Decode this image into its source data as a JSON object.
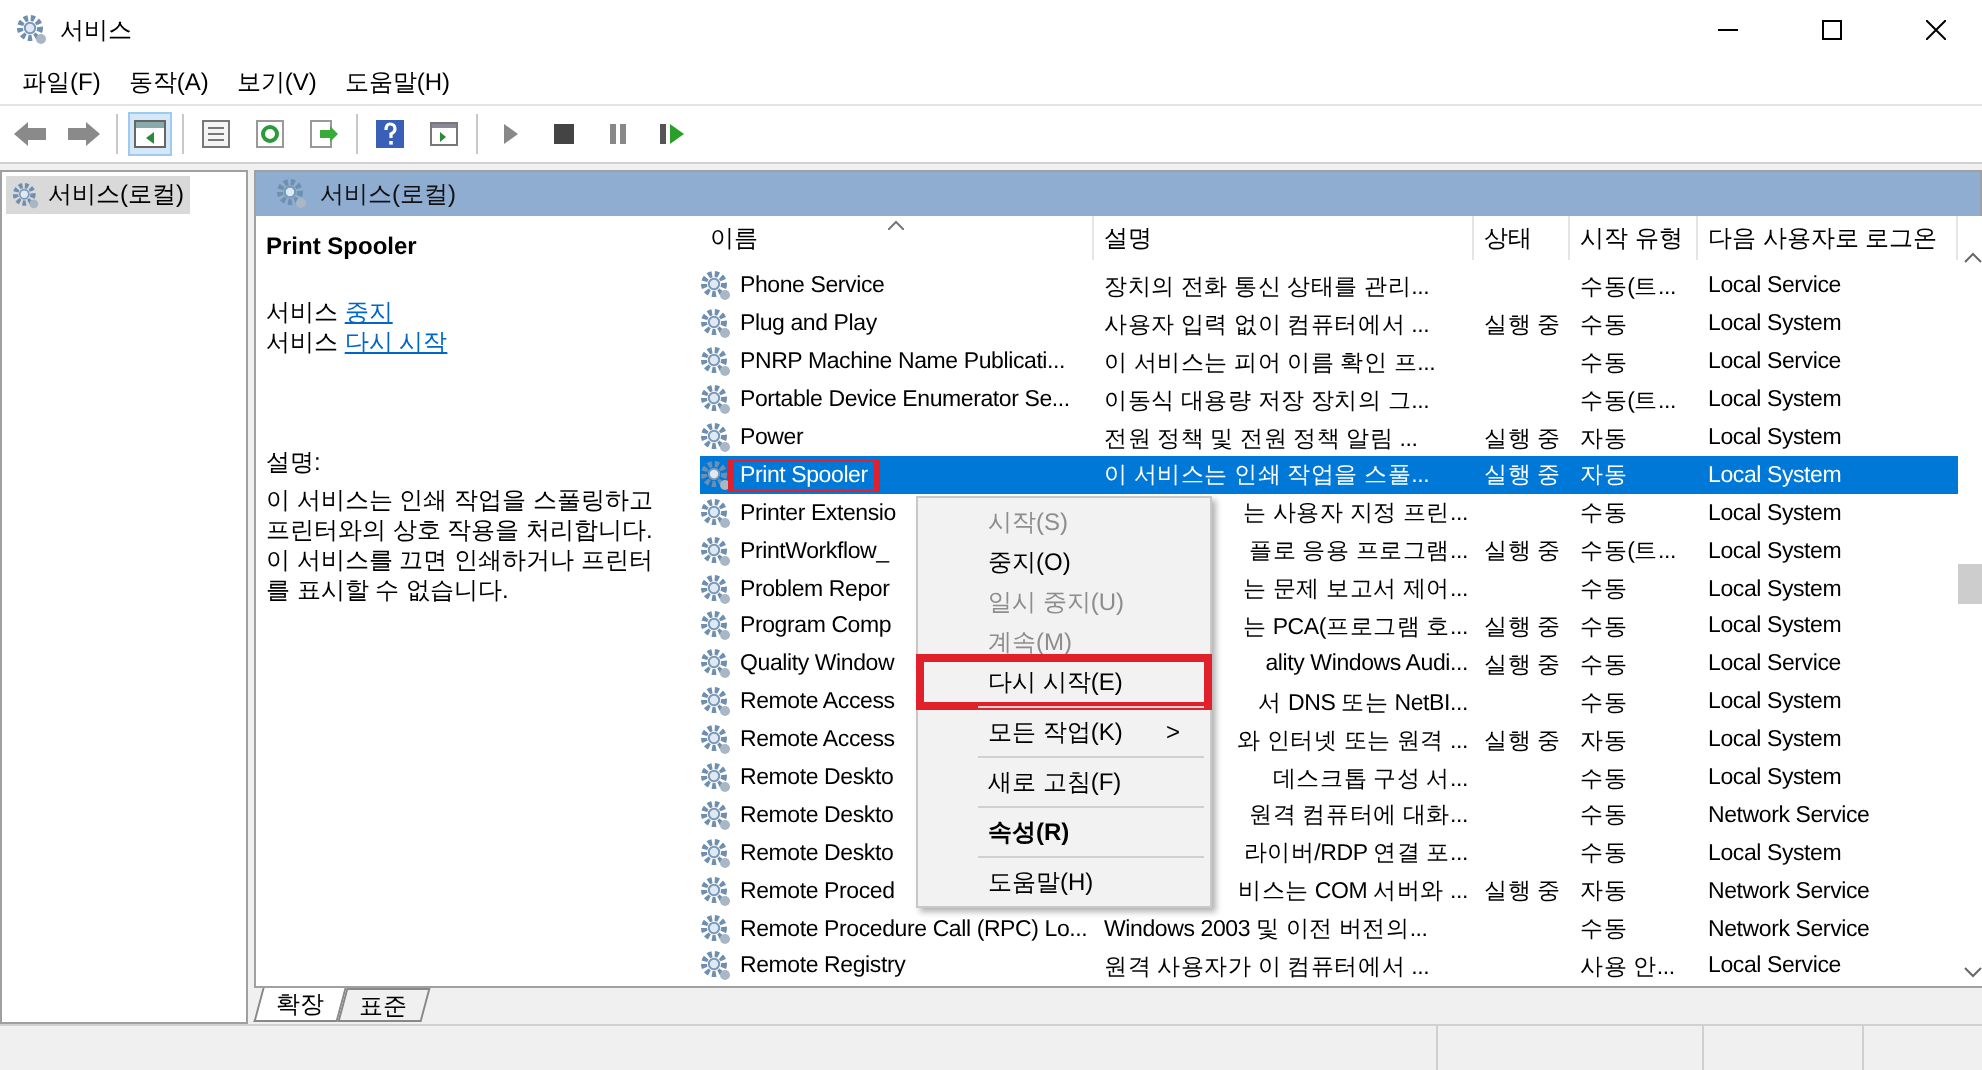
{
  "window": {
    "title": "서비스"
  },
  "menu_bar": [
    "파일(F)",
    "동작(A)",
    "보기(V)",
    "도움말(H)"
  ],
  "tree": [
    {
      "label": "서비스(로컬)",
      "selected": true
    }
  ],
  "panel_title": "서비스(로컬)",
  "details": {
    "service_name": "Print Spooler",
    "actions": [
      {
        "prefix": "서비스",
        "link": "중지"
      },
      {
        "prefix": "서비스",
        "link": "다시 시작"
      }
    ],
    "description_label": "설명:",
    "description": "이 서비스는 인쇄 작업을 스풀링하고 프린터와의 상호 작용을 처리합니다. 이 서비스를 끄면 인쇄하거나 프린터를 표시할 수 없습니다."
  },
  "table": {
    "columns": [
      "이름",
      "설명",
      "상태",
      "시작 유형",
      "다음 사용자로 로그온"
    ],
    "rows": [
      {
        "name": "Phone Service",
        "description": "장치의 전화 통신 상태를 관리...",
        "status": "",
        "startup": "수동(트...",
        "logon": "Local Service",
        "selected": false,
        "covered": false
      },
      {
        "name": "Plug and Play",
        "description": "사용자 입력 없이 컴퓨터에서 ...",
        "status": "실행 중",
        "startup": "수동",
        "logon": "Local System",
        "selected": false,
        "covered": false
      },
      {
        "name": "PNRP Machine Name Publicati...",
        "description": "이 서비스는 피어 이름 확인 프...",
        "status": "",
        "startup": "수동",
        "logon": "Local Service",
        "selected": false,
        "covered": false
      },
      {
        "name": "Portable Device Enumerator Se...",
        "description": "이동식 대용량 저장 장치의 그...",
        "status": "",
        "startup": "수동(트...",
        "logon": "Local System",
        "selected": false,
        "covered": false
      },
      {
        "name": "Power",
        "description": "전원 정책 및 전원 정책 알림 ...",
        "status": "실행 중",
        "startup": "자동",
        "logon": "Local System",
        "selected": false,
        "covered": false
      },
      {
        "name": "Print Spooler",
        "description": "이 서비스는 인쇄 작업을 스풀...",
        "status": "실행 중",
        "startup": "자동",
        "logon": "Local System",
        "selected": true,
        "covered": false,
        "marked": true
      },
      {
        "name": "Printer Extensio",
        "description": "는 사용자 지정 프린...",
        "status": "",
        "startup": "수동",
        "logon": "Local System",
        "selected": false,
        "covered": true
      },
      {
        "name": "PrintWorkflow_",
        "description": "플로 응용 프로그램...",
        "status": "실행 중",
        "startup": "수동(트...",
        "logon": "Local System",
        "selected": false,
        "covered": true
      },
      {
        "name": "Problem Repor",
        "description": "는 문제 보고서 제어...",
        "status": "",
        "startup": "수동",
        "logon": "Local System",
        "selected": false,
        "covered": true
      },
      {
        "name": "Program Comp",
        "description": "는 PCA(프로그램 호...",
        "status": "실행 중",
        "startup": "수동",
        "logon": "Local System",
        "selected": false,
        "covered": true
      },
      {
        "name": "Quality Window",
        "description": "ality Windows Audi...",
        "status": "실행 중",
        "startup": "수동",
        "logon": "Local Service",
        "selected": false,
        "covered": true
      },
      {
        "name": "Remote Access",
        "description": "서 DNS 또는 NetBI...",
        "status": "",
        "startup": "수동",
        "logon": "Local System",
        "selected": false,
        "covered": true
      },
      {
        "name": "Remote Access",
        "description": "와 인터넷 또는 원격 ...",
        "status": "실행 중",
        "startup": "자동",
        "logon": "Local System",
        "selected": false,
        "covered": true
      },
      {
        "name": "Remote Deskto",
        "description": "데스크톱 구성 서...",
        "status": "",
        "startup": "수동",
        "logon": "Local System",
        "selected": false,
        "covered": true
      },
      {
        "name": "Remote Deskto",
        "description": "원격 컴퓨터에 대화...",
        "status": "",
        "startup": "수동",
        "logon": "Network Service",
        "selected": false,
        "covered": true
      },
      {
        "name": "Remote Deskto",
        "description": "라이버/RDP 연결 포...",
        "status": "",
        "startup": "수동",
        "logon": "Local System",
        "selected": false,
        "covered": true
      },
      {
        "name": "Remote Proced",
        "description": "비스는 COM 서버와 ...",
        "status": "실행 중",
        "startup": "자동",
        "logon": "Network Service",
        "selected": false,
        "covered": true
      },
      {
        "name": "Remote Procedure Call (RPC) Lo...",
        "description": "Windows 2003 및 이전 버전의...",
        "status": "",
        "startup": "수동",
        "logon": "Network Service",
        "selected": false,
        "covered": false
      },
      {
        "name": "Remote Registry",
        "description": "원격 사용자가 이 컴퓨터에서 ...",
        "status": "",
        "startup": "사용 안...",
        "logon": "Local Service",
        "selected": false,
        "covered": false
      }
    ]
  },
  "context_menu": [
    {
      "label": "시작(S)",
      "kind": "item",
      "disabled": true
    },
    {
      "label": "중지(O)",
      "kind": "item",
      "disabled": false
    },
    {
      "label": "일시 중지(U)",
      "kind": "item",
      "disabled": true
    },
    {
      "label": "계속(M)",
      "kind": "item",
      "disabled": true
    },
    {
      "label": "다시 시작(E)",
      "kind": "item",
      "disabled": false,
      "marked": true
    },
    {
      "kind": "separator"
    },
    {
      "label": "모든 작업(K)",
      "kind": "submenu",
      "disabled": false,
      "arrow": ">"
    },
    {
      "kind": "separator"
    },
    {
      "label": "새로 고침(F)",
      "kind": "item",
      "disabled": false
    },
    {
      "kind": "separator"
    },
    {
      "label": "속성(R)",
      "kind": "default",
      "disabled": false
    },
    {
      "kind": "separator"
    },
    {
      "label": "도움말(H)",
      "kind": "item",
      "disabled": false
    }
  ],
  "bottom_tabs": [
    {
      "label": "확장",
      "selected": true
    },
    {
      "label": "표준",
      "selected": false
    }
  ]
}
